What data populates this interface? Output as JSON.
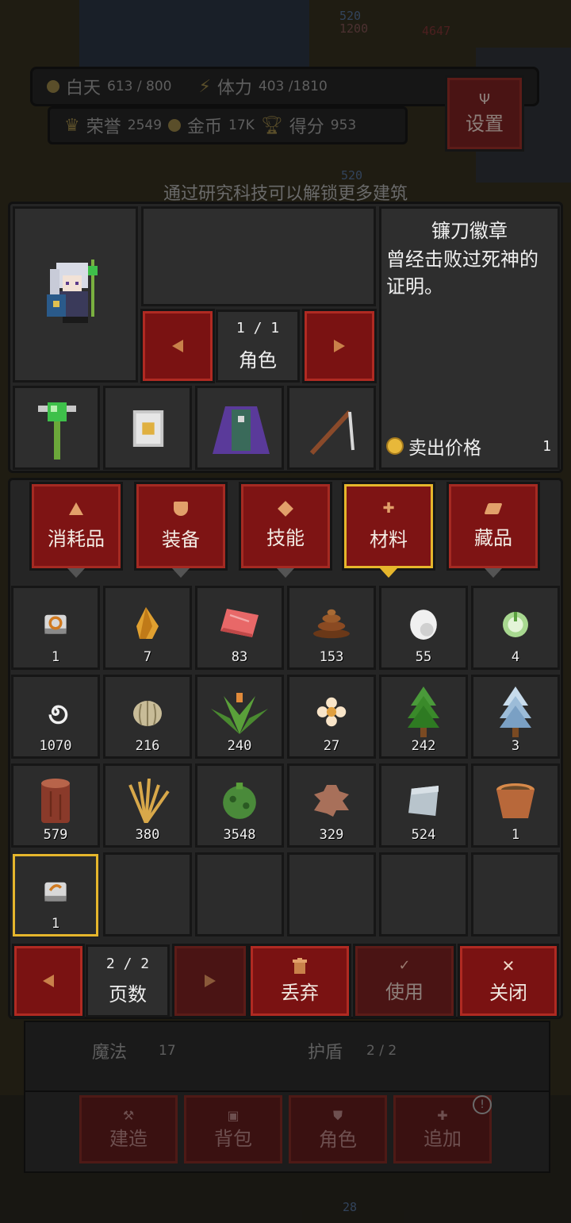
{
  "hud": {
    "day_label": "白天",
    "day_value": "613 / 800",
    "stamina_label": "体力",
    "stamina_value": "403 /1810",
    "honor_label": "荣誉",
    "honor_value": "2549",
    "gold_label": "金币",
    "gold_value": "17K",
    "score_label": "得分",
    "score_value": "953",
    "settings_label": "设置"
  },
  "bg_numbers": {
    "top_left_a": "520",
    "top_left_b": "1200",
    "top_right": "4647",
    "mid": "520",
    "bottom": "28"
  },
  "hint": "通过研究科技可以解锁更多建筑",
  "character": {
    "page": "1 / 1",
    "label": "角色"
  },
  "item_detail": {
    "name": "镰刀徽章",
    "description": "曾经击败过死神的证明。",
    "sell_label": "卖出价格",
    "sell_value": "1"
  },
  "tabs": [
    {
      "label": "消耗品",
      "icon": "flask-icon"
    },
    {
      "label": "装备",
      "icon": "shield-icon"
    },
    {
      "label": "技能",
      "icon": "diamond-icon"
    },
    {
      "label": "材料",
      "icon": "material-icon"
    },
    {
      "label": "藏品",
      "icon": "leaf-icon"
    }
  ],
  "active_tab": "材料",
  "items": [
    {
      "name": "scythe-badge-icon",
      "count": "1"
    },
    {
      "name": "amber-icon",
      "count": "7"
    },
    {
      "name": "meat-icon",
      "count": "83"
    },
    {
      "name": "dung-icon",
      "count": "153"
    },
    {
      "name": "egg-icon",
      "count": "55"
    },
    {
      "name": "cabbage-icon",
      "count": "4"
    },
    {
      "name": "spiral-icon",
      "count": "1070"
    },
    {
      "name": "onion-icon",
      "count": "216"
    },
    {
      "name": "herb-icon",
      "count": "240"
    },
    {
      "name": "flower-icon",
      "count": "27"
    },
    {
      "name": "pine-tree-icon",
      "count": "242"
    },
    {
      "name": "snow-tree-icon",
      "count": "3"
    },
    {
      "name": "log-icon",
      "count": "579"
    },
    {
      "name": "wheat-icon",
      "count": "380"
    },
    {
      "name": "bush-icon",
      "count": "3548"
    },
    {
      "name": "hide-icon",
      "count": "329"
    },
    {
      "name": "cloth-icon",
      "count": "524"
    },
    {
      "name": "pot-icon",
      "count": "1"
    },
    {
      "name": "scythe-badge-icon",
      "count": "1"
    }
  ],
  "pager": {
    "page": "2 / 2",
    "label": "页数"
  },
  "actions": {
    "discard": "丢弃",
    "use": "使用",
    "close": "关闭"
  },
  "stats_bg": {
    "magic_label": "魔法",
    "magic_value": "17",
    "shield_label": "护盾",
    "shield_value": "2 / 2"
  },
  "bottom_nav": {
    "build": "建造",
    "bag": "背包",
    "character": "角色",
    "add": "追加"
  }
}
